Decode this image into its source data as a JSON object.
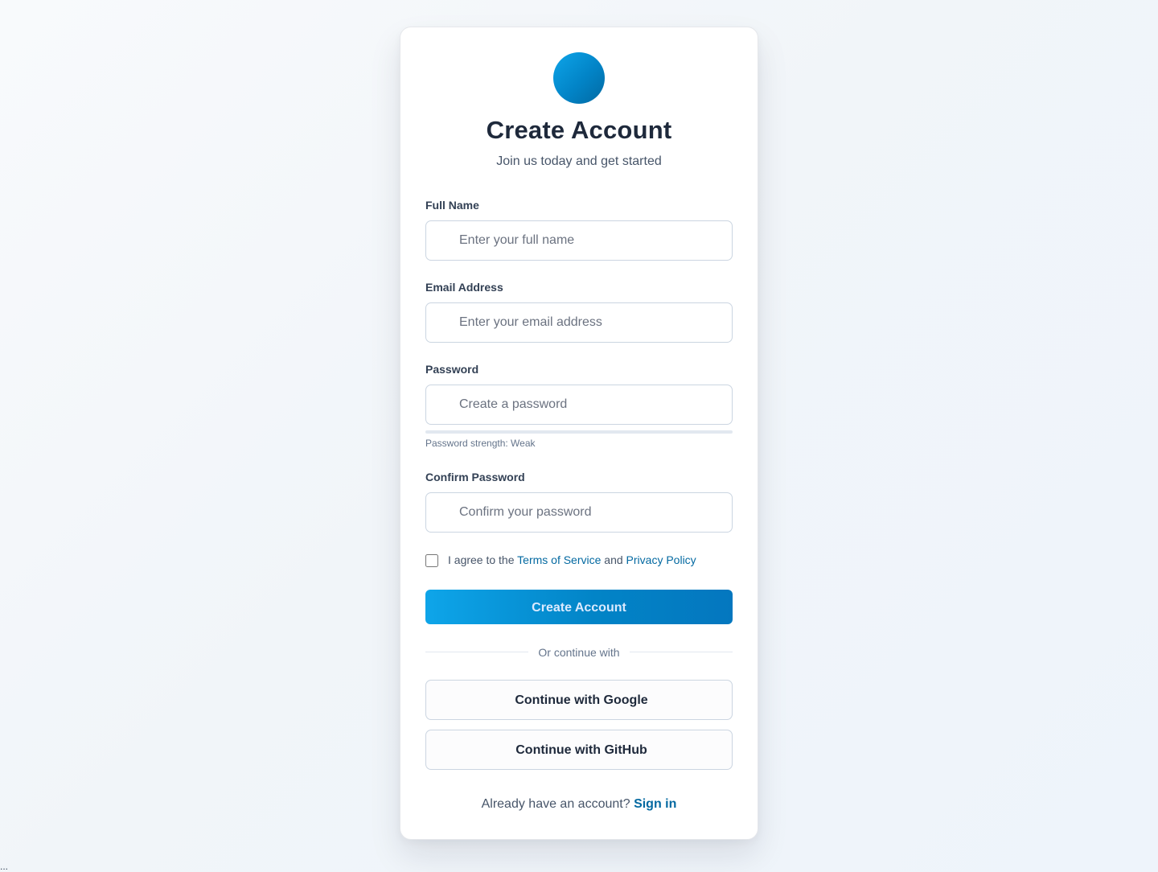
{
  "form": {
    "title": "Create Account",
    "subtitle": "Join us today and get started",
    "fields": {
      "full_name": {
        "label": "Full Name",
        "placeholder": "Enter your full name",
        "value": ""
      },
      "email": {
        "label": "Email Address",
        "placeholder": "Enter your email address",
        "value": ""
      },
      "password": {
        "label": "Password",
        "placeholder": "Create a password",
        "value": ""
      },
      "confirm_password": {
        "label": "Confirm Password",
        "placeholder": "Confirm your password",
        "value": ""
      }
    },
    "password_strength": {
      "text": "Password strength: Weak",
      "level": 0
    },
    "terms": {
      "prefix": "I agree to the",
      "terms_link": "Terms of Service",
      "conjunction": "and",
      "privacy_link": "Privacy Policy",
      "checked": false
    },
    "submit_label": "Create Account",
    "divider_text": "Or continue with",
    "social": {
      "google_label": "Continue with Google",
      "github_label": "Continue with GitHub"
    },
    "signin": {
      "prompt": "Already have an account?",
      "link": "Sign in"
    }
  },
  "colors": {
    "accent": "#0284c7",
    "link": "#0369a1",
    "logo_gradient_start": "#0ea5e9",
    "logo_gradient_end": "#0369a1"
  },
  "icons": {
    "logo": "circle-logo-icon"
  },
  "corner_text": "..."
}
